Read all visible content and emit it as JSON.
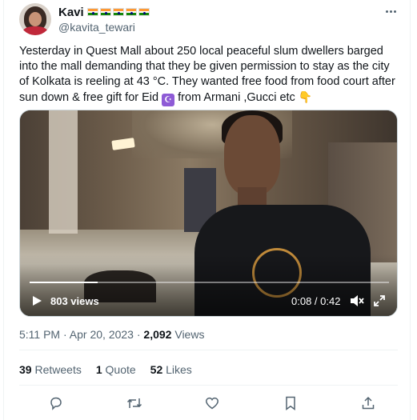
{
  "author": {
    "name": "Kavi",
    "handle": "@kavita_tewari",
    "flag_emoji_count": 5
  },
  "tweet": {
    "text_main": "Yesterday in Quest Mall  about 250 local peaceful slum dwellers barged into the mall demanding that they be given permission to stay as the city of Kolkata is reeling at 43 °C. They wanted free food from food court after sun down & free gift for Eid ",
    "text_end": " from Armani ,Gucci etc ",
    "moon_emoji": "☪",
    "hand_emoji": "👇"
  },
  "video": {
    "views": "803 views",
    "time": "0:08 / 0:42",
    "progress_fraction": 0.19
  },
  "meta": {
    "time": "5:11 PM",
    "sep1": "·",
    "date": "Apr 20, 2023",
    "sep2": "·",
    "view_count": "2,092",
    "views_label": "Views"
  },
  "stats": {
    "retweets_count": "39",
    "retweets_label": "Retweets",
    "quotes_count": "1",
    "quotes_label": "Quote",
    "likes_count": "52",
    "likes_label": "Likes"
  },
  "colors": {
    "text": "#0f1419",
    "secondary": "#536471",
    "border": "#eff3f4"
  },
  "icons": [
    "more-icon",
    "play-icon",
    "volume-muted-icon",
    "expand-icon",
    "reply-icon",
    "retweet-icon",
    "like-icon",
    "bookmark-icon",
    "share-icon"
  ]
}
